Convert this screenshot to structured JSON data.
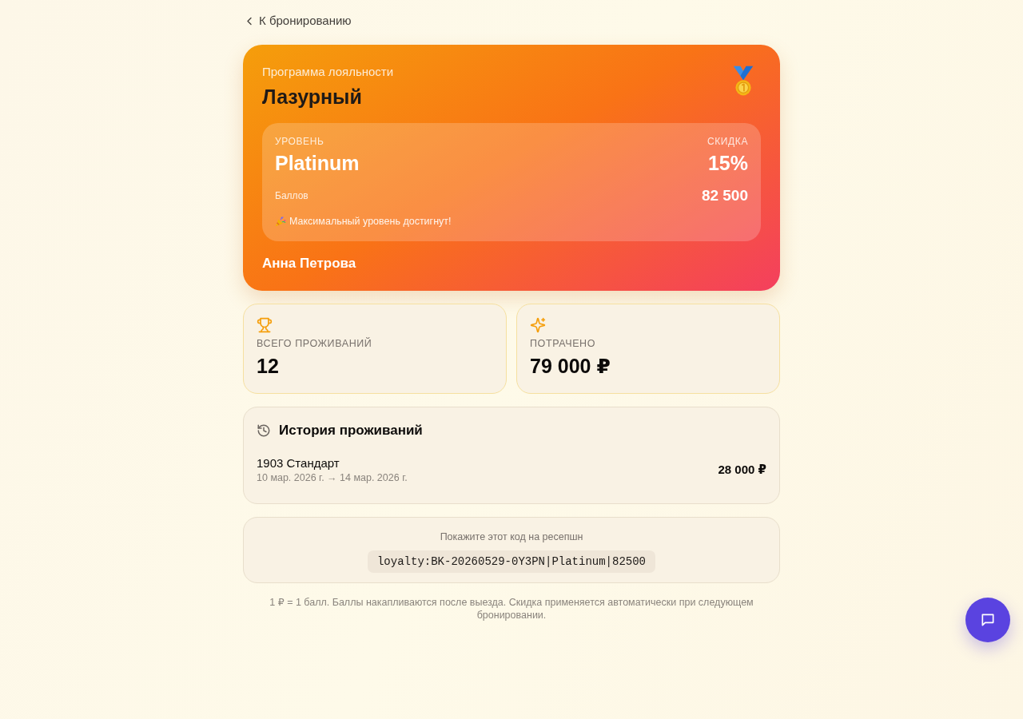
{
  "back_link": {
    "label": "К бронированию"
  },
  "loyalty_card": {
    "program_label": "Программа лояльности",
    "program_name": "Лазурный",
    "tier_panel": {
      "tier_label": "УРОВЕНЬ",
      "tier": "Platinum",
      "discount_label": "СКИДКА",
      "discount": "15%",
      "points_label": "Баллов",
      "points": "82 500",
      "status_note": "Максимальный уровень достигнут!"
    },
    "holder_name": "Анна Петрова"
  },
  "stats": [
    {
      "label": "ВСЕГО ПРОЖИВАНИЙ",
      "value": "12"
    },
    {
      "label": "ПОТРАЧЕНО",
      "value": "79 000 ₽"
    }
  ],
  "history": {
    "title": "История проживаний",
    "stays": [
      {
        "room": "1903 Стандарт",
        "dates": "10 мар. 2026 г. → 14 мар. 2026 г.",
        "amount": "28 000 ₽"
      }
    ]
  },
  "code_card": {
    "hint": "Покажите этот код на ресепшн",
    "code": "loyalty:BK-20260529-0Y3PN|Platinum|82500"
  },
  "footnote": "1 ₽ = 1 балл. Баллы накапливаются после выезда. Скидка применяется автоматически при следующем бронировании."
}
